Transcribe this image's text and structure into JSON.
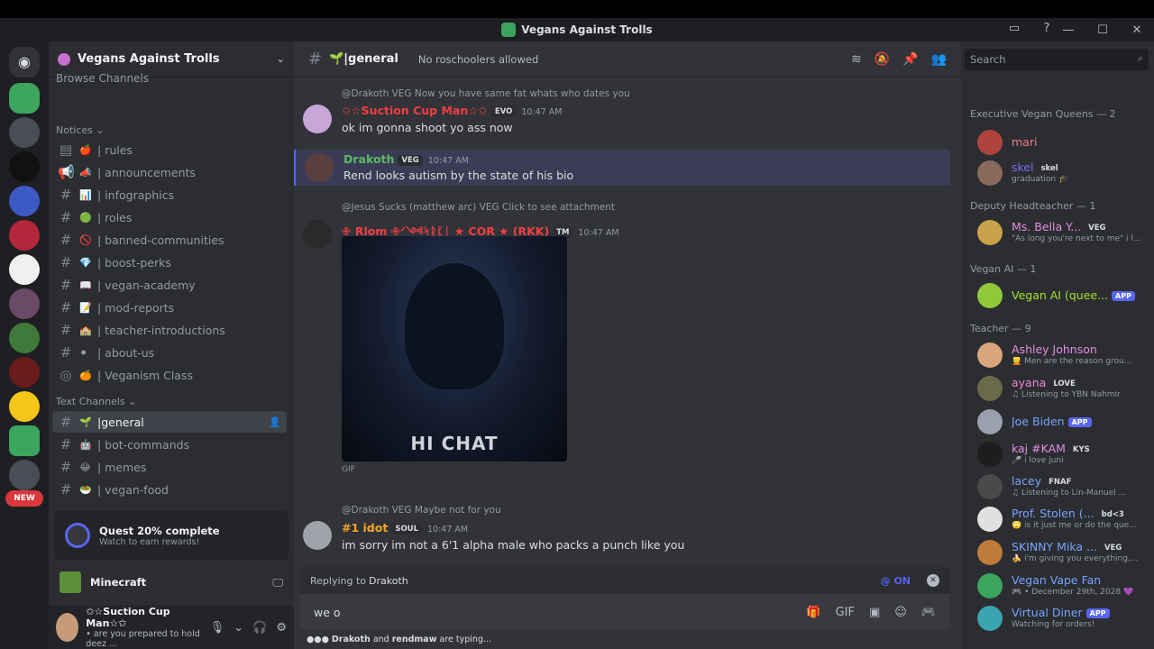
{
  "window": {
    "title": "Vegans Against Trolls"
  },
  "server": {
    "name": "Vegans Against Trolls",
    "browse": "Browse Channels"
  },
  "categories": {
    "notices": "Notices",
    "text": "Text Channels"
  },
  "channels": [
    {
      "emoji": "🍎",
      "name": "| rules"
    },
    {
      "emoji": "📣",
      "name": "| announcements"
    },
    {
      "emoji": "📊",
      "name": "| infographics"
    },
    {
      "emoji": "🟢",
      "name": "| roles"
    },
    {
      "emoji": "🚫",
      "name": "| banned-communities"
    },
    {
      "emoji": "💎",
      "name": "| boost-perks"
    },
    {
      "emoji": "📖",
      "name": "| vegan-academy"
    },
    {
      "emoji": "📝",
      "name": "| mod-reports"
    },
    {
      "emoji": "🏫",
      "name": "| teacher-introductions"
    },
    {
      "emoji": "⚫",
      "name": "| about-us"
    },
    {
      "emoji": "🍊",
      "name": "| Veganism Class"
    }
  ],
  "text_channels": [
    {
      "emoji": "🌱",
      "name": "|general"
    },
    {
      "emoji": "🤖",
      "name": "| bot-commands"
    },
    {
      "emoji": "😂",
      "name": "| memes"
    },
    {
      "emoji": "🥗",
      "name": "| vegan-food"
    }
  ],
  "guild_badge": "NEW",
  "quest": {
    "title": "Quest 20% complete",
    "sub": "Watch to earn rewards!"
  },
  "activity": {
    "game": "Minecraft"
  },
  "user": {
    "name": "✩☆Suction Cup Man☆✩",
    "status": "• are you prepared to hold deez ..."
  },
  "chat": {
    "channel": "🌱|general",
    "topic": "No roschoolers allowed",
    "messages": [
      {
        "author": "✩☆Suction Cup Man☆✩",
        "tag": "EVO",
        "time": "10:47 AM",
        "text": "ok im gonna shoot yo ass now",
        "reply": "@Drakoth  VEG  Now you have same fat whats who dates you"
      },
      {
        "author": "Drakoth",
        "tag": "VEG",
        "time": "10:47 AM",
        "text": "Rend looks autism by the state of his bio"
      },
      {
        "author": "✙ Rlom ✙ᐟ༺ᛋᚱᛕᛁ ★ COR ★ (RKK)",
        "tag": "TM",
        "time": "10:47 AM",
        "reply": "@Jesus Sucks (matthew arc)  VEG  Click to see attachment",
        "gif_caption": "HI CHAT",
        "gif_label": "GIF"
      },
      {
        "author": "#1 idot",
        "tag": "SOUL",
        "time": "10:47 AM",
        "text": "im sorry im not a 6'1 alpha male who packs a punch like you",
        "reply": "@Drakoth  VEG  Maybe not for you"
      }
    ]
  },
  "composer": {
    "replying_label": "Replying to",
    "replying_to": "Drakoth",
    "mention": "@ ON",
    "value": "we o"
  },
  "typing": {
    "names": "Drakoth",
    "and": "and",
    "names2": "rendmaw",
    "suffix": "are typing..."
  },
  "members": {
    "search_placeholder": "Search",
    "roles": [
      {
        "name": "Executive Vegan Queens — 2",
        "color": "#949ba4"
      },
      {
        "name": "Deputy Headteacher — 1",
        "color": "#949ba4"
      },
      {
        "name": "Vegan AI — 1",
        "color": "#949ba4"
      },
      {
        "name": "Teacher — 9",
        "color": "#949ba4"
      }
    ],
    "list": [
      {
        "name": "mari",
        "color": "#f47b8e",
        "sub": ""
      },
      {
        "name": "skel",
        "color": "#7c6cf0",
        "tag": "skel",
        "sub": "graduation 🎓"
      },
      {
        "name": "Ms. Bella Y...",
        "color": "#e58ee0",
        "tag": "VEG",
        "sub": "\"As long you're next to me\" i l..."
      },
      {
        "name": "Vegan AI (quee...",
        "color": "#a6e22e",
        "app": "APP",
        "sub": ""
      },
      {
        "name": "Ashley Johnson",
        "color": "#e58ee0",
        "sub": "👱 Men are the reason grou..."
      },
      {
        "name": "ayana",
        "color": "#f08ad0",
        "tag": "LOVE",
        "sub": "♫ Listening to YBN Nahmir"
      },
      {
        "name": "Joe Biden",
        "color": "#7aa2ff",
        "app": "APP",
        "sub": ""
      },
      {
        "name": "kaj #KAM",
        "color": "#e58ee0",
        "tag": "KYS",
        "sub": "🎤 i love juni"
      },
      {
        "name": "lacey",
        "color": "#7aa2ff",
        "tag": "FNAF",
        "sub": "♫ Listening to Lin-Manuel ..."
      },
      {
        "name": "Prof. Stolen (...",
        "color": "#7aa2ff",
        "tag": "bd<3",
        "sub": "🙄 is it just me or do the que..."
      },
      {
        "name": "SKINNY Mika ...",
        "color": "#7aa2ff",
        "tag": "VEG",
        "sub": "🍌 i'm giving you everything,..."
      },
      {
        "name": "Vegan Vape Fan",
        "color": "#7aa2ff",
        "sub": "🎮 • December 29th, 2028 💜"
      },
      {
        "name": "Virtual Diner",
        "color": "#7aa2ff",
        "app": "APP",
        "sub": "Watching for orders!"
      }
    ]
  },
  "colors": {
    "accent": "#5865f2",
    "online": "#23a55a",
    "dnd": "#f23f43"
  }
}
